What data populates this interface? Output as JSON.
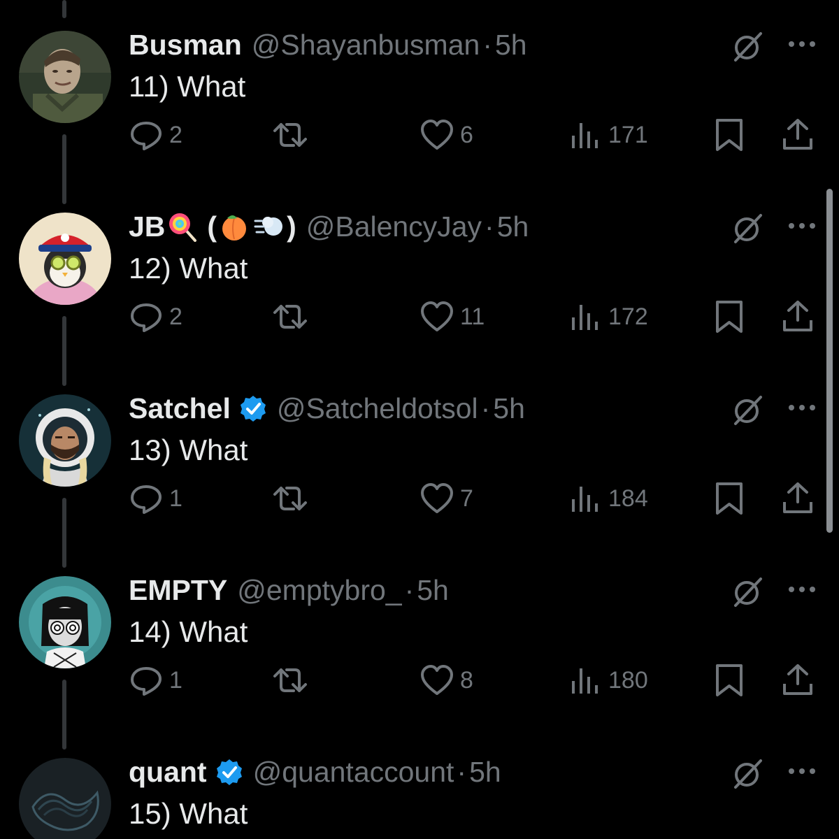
{
  "tweets": [
    {
      "name": "Busman",
      "handle": "@Shayanbusman",
      "separator": "·",
      "time": "5h",
      "text": "11) What",
      "replies": "2",
      "likes": "6",
      "views": "171",
      "verified": false
    },
    {
      "name": "JB",
      "name_suffix_open": "(",
      "name_suffix_close": ")",
      "handle": "@BalencyJay",
      "separator": "·",
      "time": "5h",
      "text": "12) What",
      "replies": "2",
      "likes": "11",
      "views": "172",
      "verified": false
    },
    {
      "name": "Satchel",
      "handle": "@Satcheldotsol",
      "separator": "·",
      "time": "5h",
      "text": "13) What",
      "replies": "1",
      "likes": "7",
      "views": "184",
      "verified": true
    },
    {
      "name": "EMPTY",
      "handle": "@emptybro_",
      "separator": "·",
      "time": "5h",
      "text": "14) What",
      "replies": "1",
      "likes": "8",
      "views": "180",
      "verified": false
    },
    {
      "name": "quant",
      "handle": "@quantaccount",
      "separator": "·",
      "time": "5h",
      "text": "15) What",
      "verified": true
    }
  ],
  "icons": {
    "reply": "reply-icon",
    "retweet": "retweet-icon",
    "like": "heart-icon",
    "views": "views-icon",
    "bookmark": "bookmark-icon",
    "share": "share-icon",
    "grok": "grok-icon",
    "more": "more-icon",
    "verified": "verified-badge-icon"
  },
  "colors": {
    "background": "#000000",
    "text_primary": "#e7e9ea",
    "text_secondary": "#71767b",
    "verified": "#1d9bf0",
    "thread_line": "#333639"
  }
}
